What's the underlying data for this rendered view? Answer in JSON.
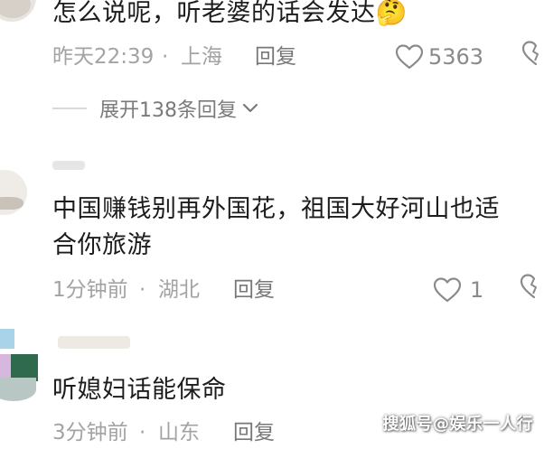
{
  "comments": [
    {
      "text": "怎么说呢，听老婆的话会发达",
      "emoji": "🤔",
      "time": "昨天22:39",
      "location": "上海",
      "reply_label": "回复",
      "like_count": "5363",
      "expand_label": "展开138条回复"
    },
    {
      "text_line1": "中国赚钱别再外国花，祖国大好河山也适",
      "text_line2": "合你旅游",
      "time": "1分钟前",
      "location": "湖北",
      "reply_label": "回复",
      "like_count": "1"
    },
    {
      "text": "听媳妇话能保命",
      "time": "3分钟前",
      "location": "山东",
      "reply_label": "回复"
    }
  ],
  "separator": "·",
  "watermark": "搜狐号@娱乐一人行",
  "colors": {
    "text": "#1c1c1c",
    "meta": "#a3a3a3",
    "icon": "#8a8a8a",
    "background": "#ffffff"
  },
  "icons": [
    "heart-outline-icon",
    "dislike-heart-icon",
    "chevron-down-icon",
    "thinking-face-emoji"
  ]
}
